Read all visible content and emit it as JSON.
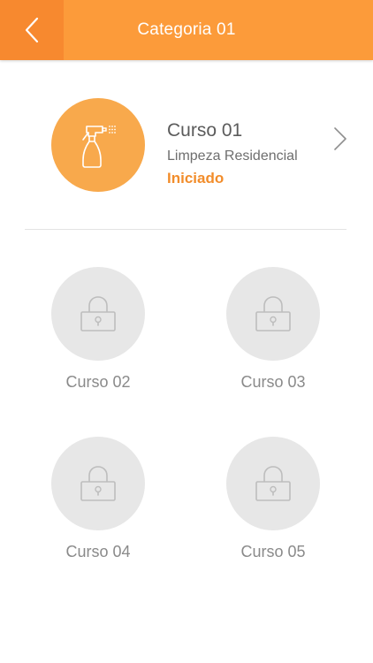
{
  "header": {
    "title": "Categoria 01",
    "back_icon": "chevron-left-icon",
    "color": "#fc9b3a"
  },
  "featured_course": {
    "title": "Curso 01",
    "subtitle": "Limpeza Residencial",
    "status": "Iniciado",
    "icon": "spray-bottle-icon",
    "accent_color": "#f28d2b"
  },
  "locked_courses": [
    {
      "label": "Curso 02",
      "icon": "lock-icon"
    },
    {
      "label": "Curso 03",
      "icon": "lock-icon"
    },
    {
      "label": "Curso 04",
      "icon": "lock-icon"
    },
    {
      "label": "Curso 05",
      "icon": "lock-icon"
    }
  ]
}
